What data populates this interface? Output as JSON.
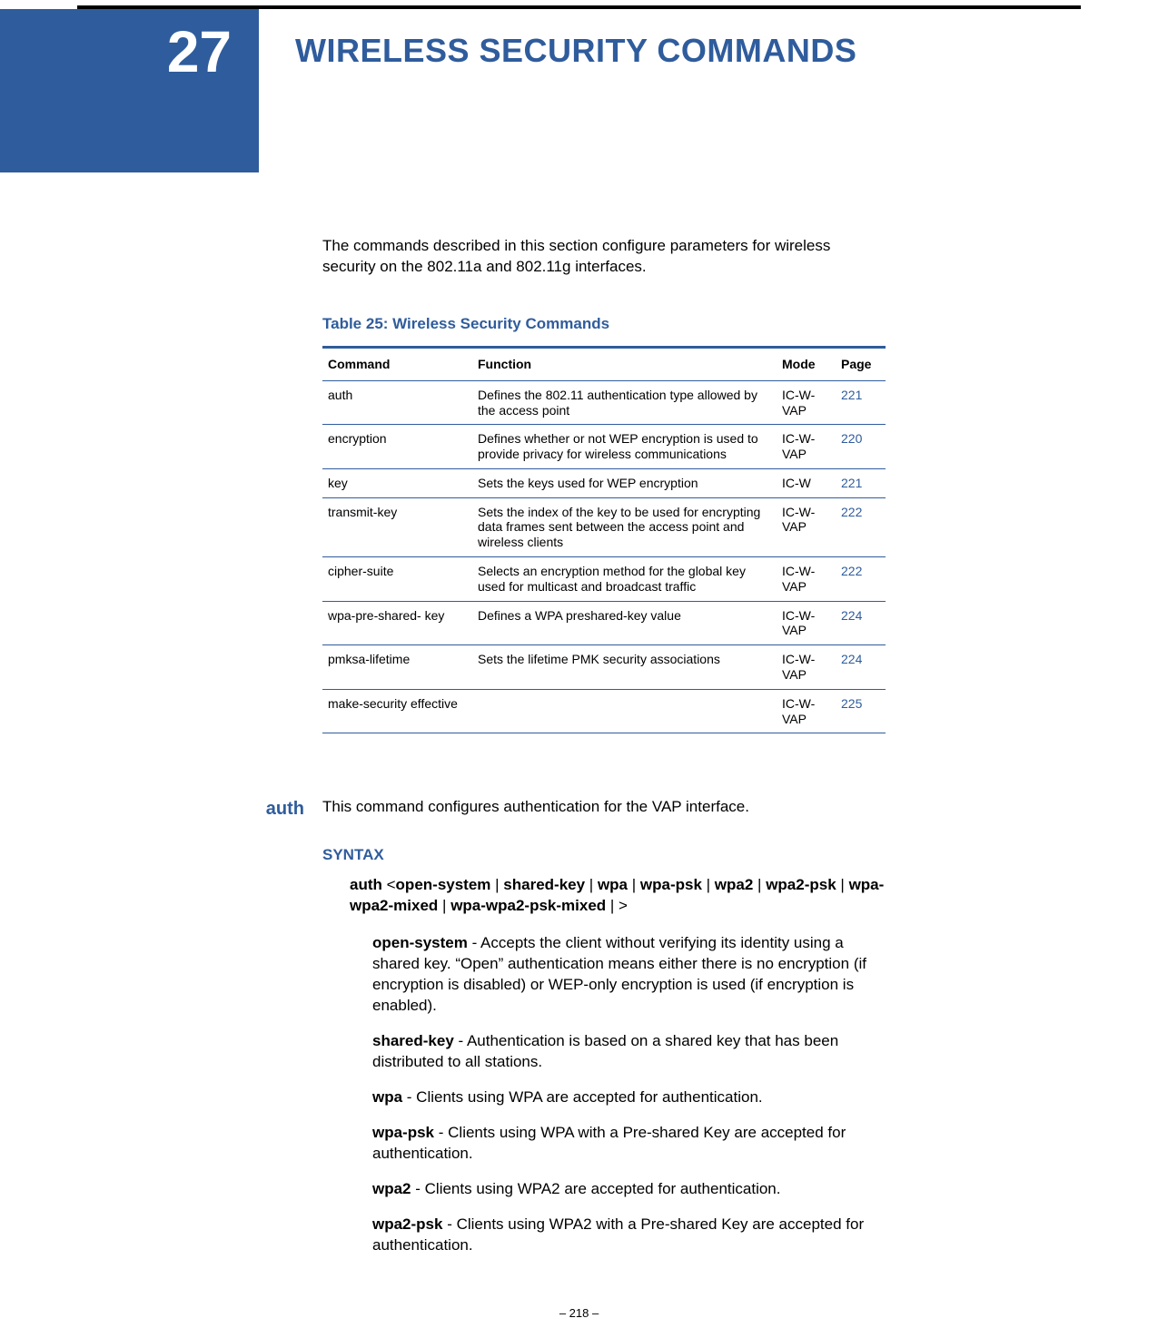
{
  "chapter_number": "27",
  "chapter_title": "WIRELESS SECURITY COMMANDS",
  "intro": "The commands described in this section configure parameters for wireless security on the 802.11a and 802.11g interfaces.",
  "table_caption": "Table 25: Wireless Security Commands",
  "table_headers": {
    "cmd": "Command",
    "func": "Function",
    "mode": "Mode",
    "page": "Page"
  },
  "table_rows": [
    {
      "cmd": "auth",
      "func": "Defines the 802.11 authentication type allowed by the access point",
      "mode": "IC-W-VAP",
      "page": "221"
    },
    {
      "cmd": "encryption",
      "func": "Defines whether or not WEP encryption is used to provide privacy for wireless communications",
      "mode": "IC-W-VAP",
      "page": "220"
    },
    {
      "cmd": "key",
      "func": "Sets the keys used for WEP encryption",
      "mode": "IC-W",
      "page": "221"
    },
    {
      "cmd": "transmit-key",
      "func": "Sets the index of the key to be used for encrypting data frames sent between the access point and wireless clients",
      "mode": "IC-W-VAP",
      "page": "222"
    },
    {
      "cmd": "cipher-suite",
      "func": "Selects an encryption method for the global key used for multicast and broadcast traffic",
      "mode": "IC-W-VAP",
      "page": "222"
    },
    {
      "cmd": "wpa-pre-shared- key",
      "func": "Defines a WPA preshared-key value",
      "mode": "IC-W-VAP",
      "page": "224"
    },
    {
      "cmd": "pmksa-lifetime",
      "func": "Sets the lifetime PMK security associations",
      "mode": "IC-W-VAP",
      "page": "224"
    },
    {
      "cmd": "make-security effective",
      "func": "",
      "mode": "IC-W-VAP",
      "page": "225"
    }
  ],
  "section_label": "auth",
  "section_intro": "This command configures authentication for the VAP interface.",
  "syntax_heading": "SYNTAX",
  "syntax_parts": [
    "auth",
    " <",
    "open-system",
    " | ",
    "shared-key",
    " | ",
    "wpa",
    " | ",
    "wpa-psk",
    " | ",
    "wpa2",
    " | ",
    "wpa2-psk",
    " |  ",
    "wpa-wpa2-mixed",
    " | ",
    "wpa-wpa2-psk-mixed",
    " | >"
  ],
  "params": [
    {
      "name": "open-system",
      "desc": " - Accepts the client without verifying its identity using a shared key. “Open” authentication means either there is no encryption (if encryption is disabled) or WEP-only encryption is used (if encryption is enabled)."
    },
    {
      "name": "shared-key",
      "desc": " - Authentication is based on a shared key that has been distributed to all stations."
    },
    {
      "name": "wpa",
      "desc": " - Clients using WPA are accepted for authentication."
    },
    {
      "name": "wpa-psk",
      "desc": " - Clients using WPA with a Pre-shared Key are accepted for authentication."
    },
    {
      "name": "wpa2",
      "desc": " - Clients using WPA2 are accepted for authentication."
    },
    {
      "name": "wpa2-psk",
      "desc": " - Clients using WPA2 with a Pre-shared Key are accepted for authentication."
    }
  ],
  "footer": "–  218  –"
}
